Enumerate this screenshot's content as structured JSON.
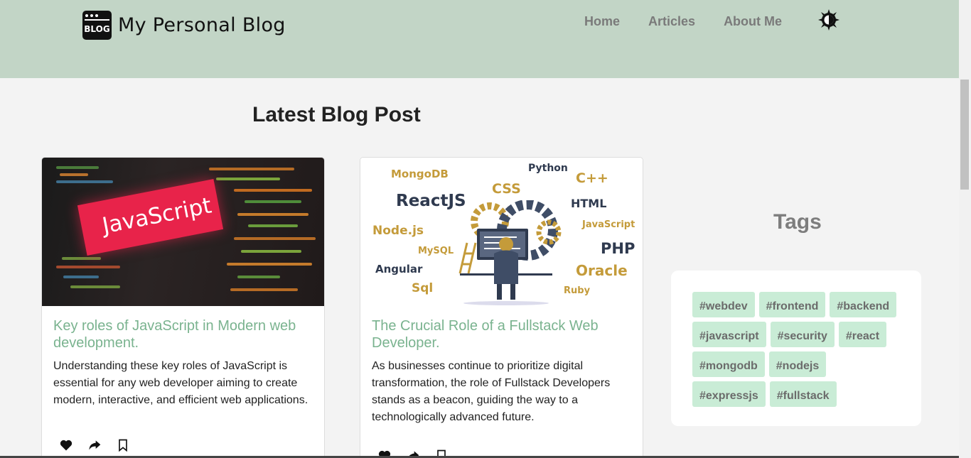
{
  "header": {
    "logo_text": "BLOG",
    "site_title": "My Personal Blog",
    "nav": [
      "Home",
      "Articles",
      "About Me"
    ],
    "theme_icon": "sun-moon-icon"
  },
  "main": {
    "section_title": "Latest Blog Post",
    "posts": [
      {
        "image_text": "JavaScript",
        "title": "Key roles of JavaScript in Modern web development.",
        "description": "Understanding these key roles of JavaScript is essential for any web developer aiming to create modern, interactive, and efficient web applications."
      },
      {
        "image_labels": [
          "MongoDB",
          "Python",
          "C++",
          "ReactJS",
          "CSS",
          "HTML",
          "Node.js",
          "JavaScript",
          "MySQL",
          "PHP",
          "Angular",
          "Oracle",
          "Sql",
          "Ruby"
        ],
        "title": "The Crucial Role of a Fullstack Web Developer.",
        "description": "As businesses continue to prioritize digital transformation, the role of Fullstack Developers stands as a beacon, guiding the way to a technologically advanced future."
      }
    ],
    "actions": [
      "heart-icon",
      "share-icon",
      "bookmark-icon"
    ]
  },
  "sidebar": {
    "tags_title": "Tags",
    "tags": [
      "#webdev",
      "#frontend",
      "#backend",
      "#javascript",
      "#security",
      "#react",
      "#mongodb",
      "#nodejs",
      "#expressjs",
      "#fullstack"
    ]
  },
  "colors": {
    "header_bg": "#c2d5c6",
    "post_title": "#7ab38f",
    "tag_bg": "#c9ecd6"
  }
}
